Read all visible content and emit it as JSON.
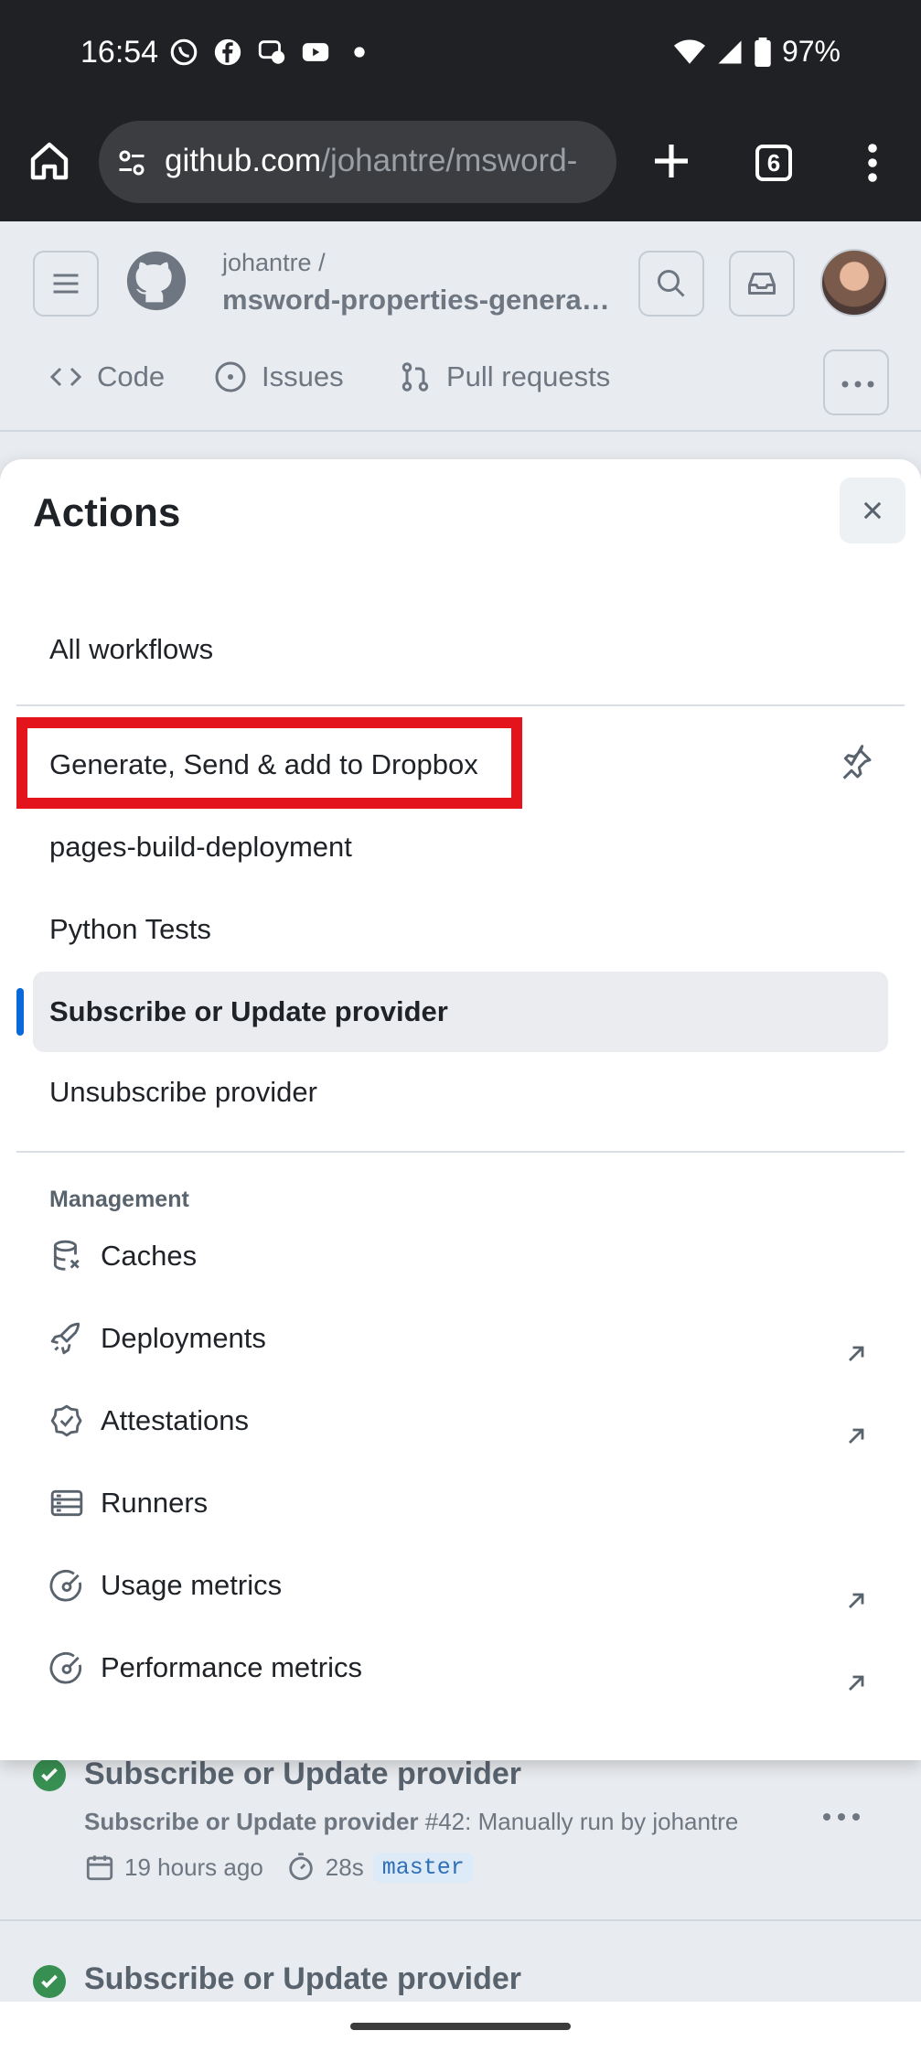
{
  "status_bar": {
    "time": "16:54",
    "battery": "97%",
    "icons": [
      "whatsapp-icon",
      "facebook-icon",
      "messenger-icon",
      "youtube-icon",
      "dot-icon",
      "wifi-icon",
      "signal-icon",
      "battery-icon"
    ]
  },
  "browser": {
    "url_host": "github.com",
    "url_path": "/johantre/msword-",
    "tab_count": "6"
  },
  "repo": {
    "owner": "johantre /",
    "name": "msword-properties-genera…",
    "nav": [
      "Code",
      "Issues",
      "Pull requests"
    ]
  },
  "sheet": {
    "title": "Actions",
    "all_workflows": "All workflows",
    "workflows": [
      "Generate, Send & add to Dropbox",
      "pages-build-deployment",
      "Python Tests",
      "Subscribe or Update provider",
      "Unsubscribe provider"
    ],
    "selected_workflow_index": 3,
    "management_label": "Management",
    "management": [
      {
        "label": "Caches",
        "icon": "database-icon",
        "external": false
      },
      {
        "label": "Deployments",
        "icon": "rocket-icon",
        "external": true
      },
      {
        "label": "Attestations",
        "icon": "verified-icon",
        "external": true
      },
      {
        "label": "Runners",
        "icon": "server-icon",
        "external": false
      },
      {
        "label": "Usage metrics",
        "icon": "meter-icon",
        "external": true
      },
      {
        "label": "Performance metrics",
        "icon": "meter-icon",
        "external": true
      }
    ]
  },
  "runs": [
    {
      "title": "Subscribe or Update provider",
      "workflow": "Subscribe or Update provider",
      "detail": "#42: Manually run by johantre",
      "time_ago": "19 hours ago",
      "duration": "28s",
      "branch": "master"
    },
    {
      "title": "Subscribe or Update provider"
    }
  ],
  "colors": {
    "highlight": "#e3141b",
    "selected_accent": "#0969da",
    "success": "#1a7f37"
  }
}
